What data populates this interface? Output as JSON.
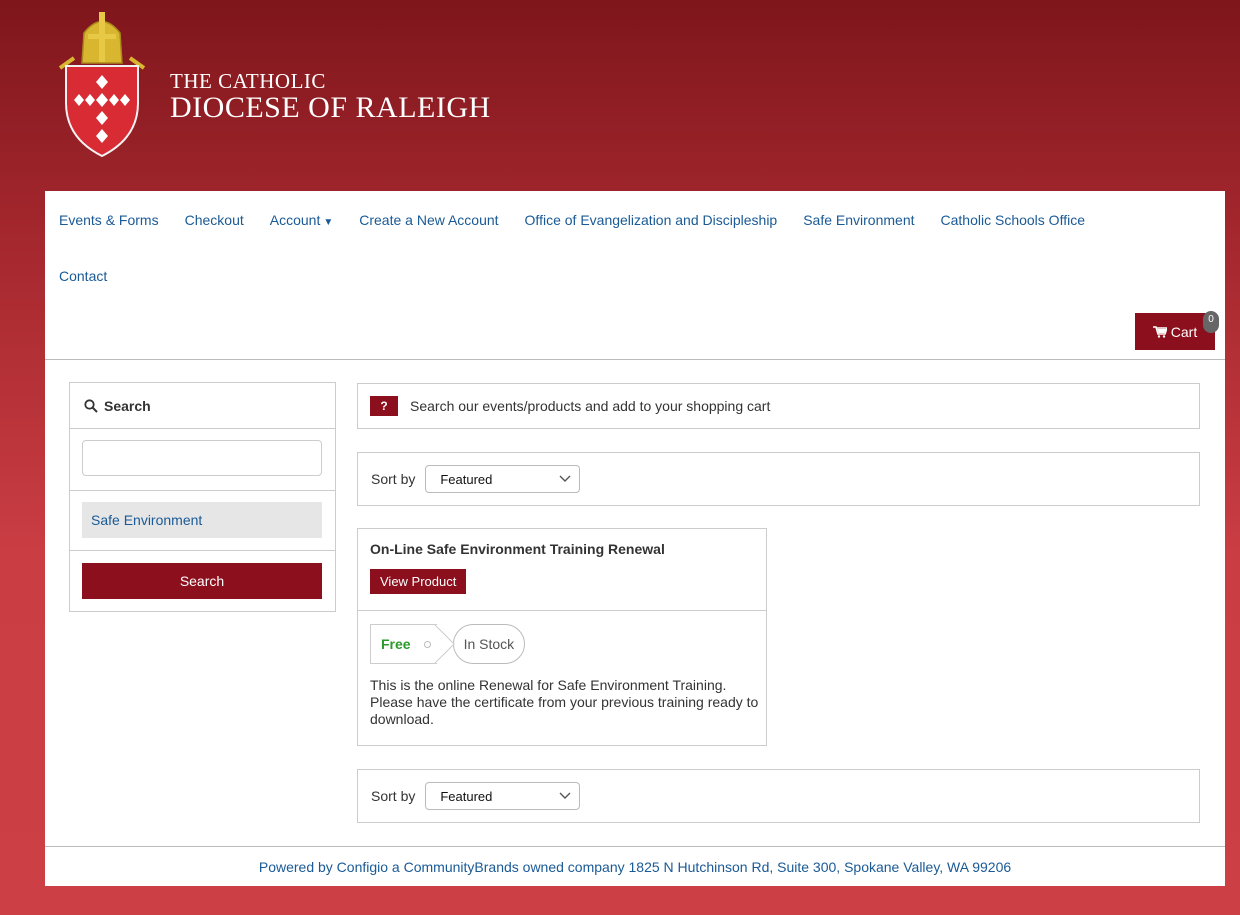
{
  "header": {
    "logo_line1": "THE CATHOLIC",
    "logo_line2": "DIOCESE OF RALEIGH"
  },
  "nav": {
    "items": [
      {
        "label": "Events & Forms"
      },
      {
        "label": "Checkout"
      },
      {
        "label": "Account"
      },
      {
        "label": "Create a New Account"
      },
      {
        "label": "Office of Evangelization and Discipleship"
      },
      {
        "label": "Safe Environment"
      },
      {
        "label": "Catholic Schools Office"
      },
      {
        "label": "Contact"
      }
    ],
    "account_caret": "▼"
  },
  "cart": {
    "label": "Cart",
    "count": "0"
  },
  "sidebar": {
    "title": "Search",
    "input_value": "",
    "category": "Safe Environment",
    "search_button": "Search"
  },
  "info": {
    "badge": "?",
    "text": "Search our events/products and add to your shopping cart"
  },
  "sort": {
    "label": "Sort by",
    "selected": "Featured"
  },
  "product": {
    "title": "On-Line Safe Environment Training Renewal",
    "view_button": "View Product",
    "price": "Free",
    "stock": "In Stock",
    "description": "This is the online Renewal for Safe Environment Training. Please have the certificate from your previous training ready to download."
  },
  "footer": {
    "text": "Powered by Configio a CommunityBrands owned company 1825 N Hutchinson Rd, Suite 300, Spokane Valley, WA 99206"
  },
  "colors": {
    "brand_red": "#8b0f1c",
    "link_blue": "#1a5a96",
    "price_green": "#2b9a2b"
  }
}
